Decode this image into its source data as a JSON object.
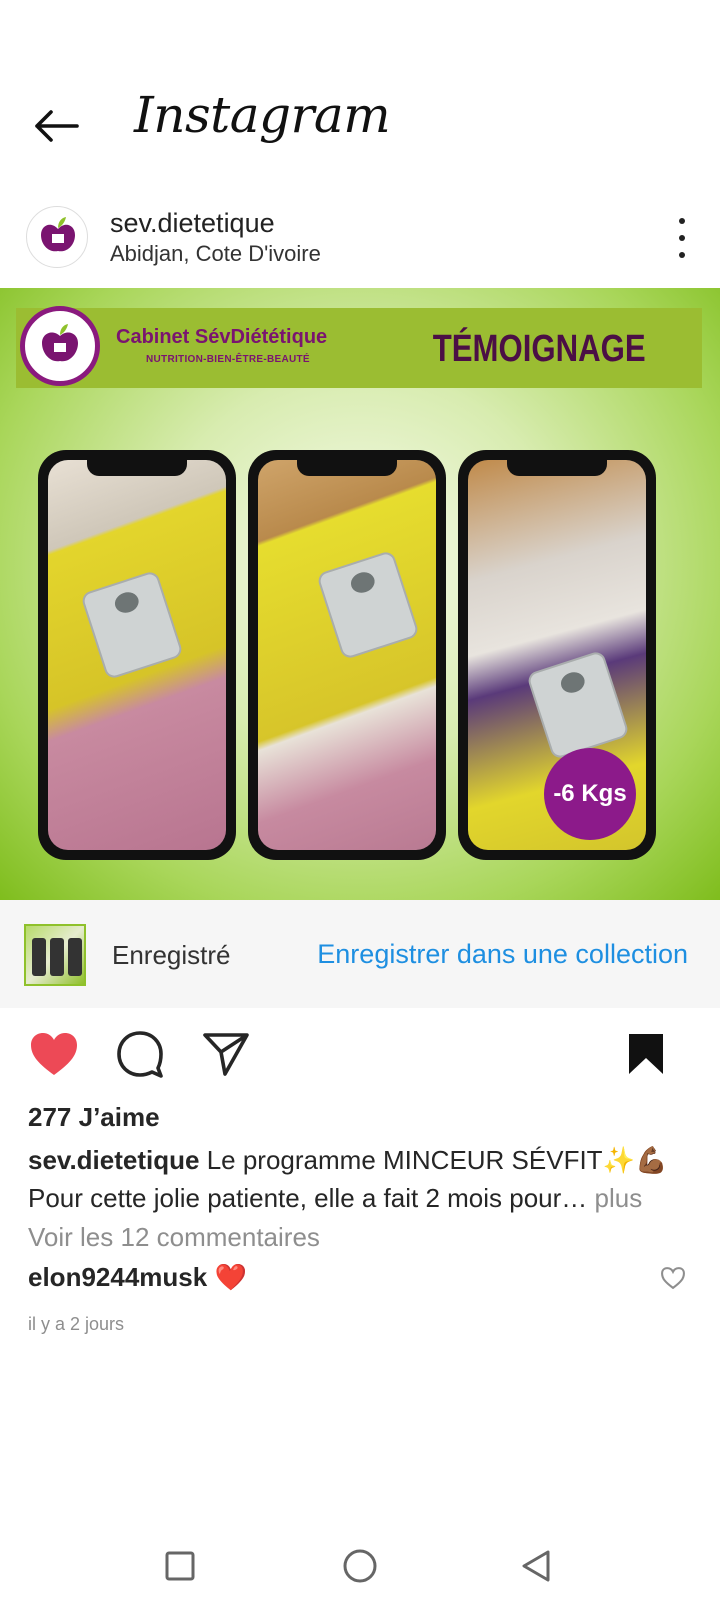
{
  "app": {
    "title": "Instagram"
  },
  "post": {
    "username": "sev.dietetique",
    "location": "Abidjan, Cote D'ivoire",
    "image": {
      "brand_title": "Cabinet SévDiététique",
      "brand_subtitle": "NUTRITION-BIEN-ÊTRE-BEAUTÉ",
      "tag": "TÉMOIGNAGE",
      "badge": "-6 Kgs"
    },
    "saved": {
      "label": "Enregistré",
      "link": "Enregistrer dans une collection"
    },
    "likes": "277 J’aime",
    "caption": {
      "user": "sev.dietetique",
      "line1": "Le programme MINCEUR SÉVFIT✨💪🏾",
      "line2": "Pour cette jolie patiente, elle a fait 2 mois pour…",
      "more": "plus"
    },
    "view_comments": "Voir les 12 commentaires",
    "comment": {
      "user": "elon9244musk",
      "text": "❤️"
    },
    "time": "il y a 2 jours"
  },
  "colors": {
    "like_red": "#ed4956",
    "link_blue": "#1e8fe1",
    "brand_purple": "#8c1a8a",
    "brand_green": "#8fc12b"
  },
  "icons": [
    "back-arrow-icon",
    "more-options-icon",
    "heart-filled-icon",
    "comment-icon",
    "share-icon",
    "bookmark-filled-icon",
    "heart-outline-icon",
    "nav-recents-icon",
    "nav-home-icon",
    "nav-back-icon"
  ]
}
